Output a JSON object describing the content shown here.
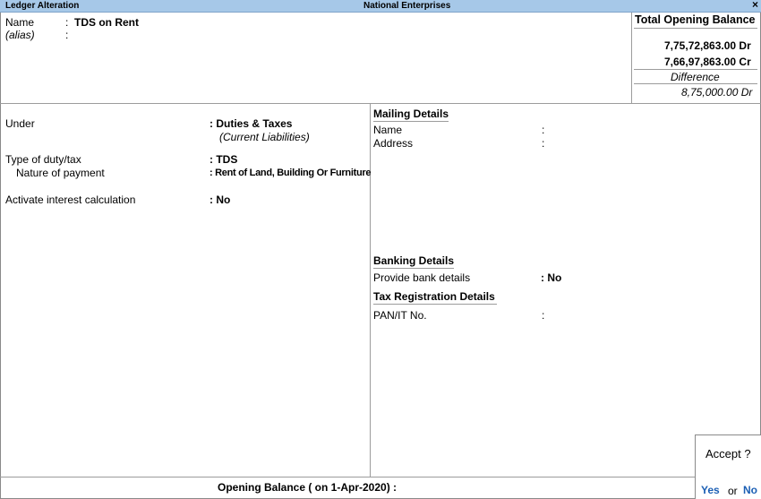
{
  "titlebar": {
    "left_title": "Ledger Alteration",
    "center_title": "National Enterprises",
    "close_glyph": "×"
  },
  "ledger": {
    "name_label": "Name",
    "name_colon": ":",
    "name_value": "TDS on Rent",
    "alias_label": "(alias)",
    "alias_colon": ":"
  },
  "balance_panel": {
    "title": "Total Opening Balance",
    "debit": "7,75,72,863.00 Dr",
    "credit": "7,66,97,863.00 Cr",
    "difference_label": "Difference",
    "difference_value": "8,75,000.00 Dr"
  },
  "left_form": {
    "under_label": "Under",
    "under_value": ": Duties & Taxes",
    "under_sub": "(Current Liabilities)",
    "duty_label": "Type of duty/tax",
    "duty_value": ": TDS",
    "nature_label": "Nature of payment",
    "nature_value": ": Rent of Land, Building Or Furniture",
    "interest_label": "Activate interest calculation",
    "interest_value": ": No"
  },
  "mailing": {
    "heading": "Mailing Details",
    "name_label": "Name",
    "address_label": "Address",
    "colon": ":"
  },
  "banking": {
    "heading": "Banking Details",
    "provide_label": "Provide bank details",
    "provide_value": ": No"
  },
  "tax": {
    "heading": "Tax Registration Details",
    "pan_label": "PAN/IT No.",
    "colon": ":"
  },
  "footer": {
    "opening_balance": "Opening Balance  ( on 1-Apr-2020) :"
  },
  "accept_dialog": {
    "question": "Accept ?",
    "yes": "Yes",
    "or": "or",
    "no": "No"
  },
  "colors": {
    "titlebar_bg": "#a6c8e8",
    "accent_blue": "#1b5fb4"
  }
}
